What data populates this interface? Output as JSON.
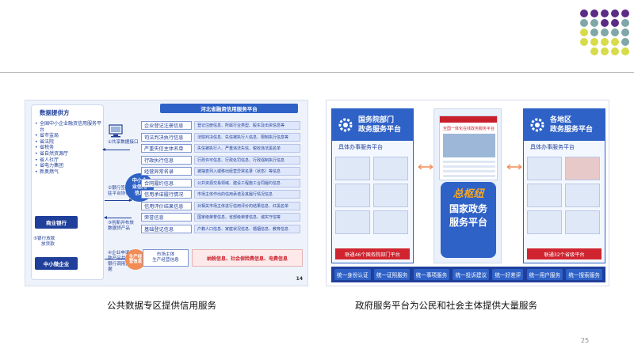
{
  "colors": {
    "dark_blue": "#1f3f9a",
    "mid_blue": "#2f62c7",
    "red": "#c8202b",
    "orange": "#f28c55",
    "dot_purple": "#5b2c86",
    "dot_teal": "#7fa7a8",
    "dot_yellow": "#d6dc4a"
  },
  "left_panel": {
    "provider_title": "数据提供方",
    "providers": [
      "全国中小企业融资信用服务平台",
      "省市监局",
      "省法院",
      "省税务",
      "省自然资源厅",
      "省人社厅",
      "省电力集团",
      "新奥燃气"
    ],
    "bank_label": "商业银行",
    "sme_label": "中小微企业",
    "step1": "①共享数据接口",
    "step2": "②银行签署入驻平台协议",
    "step3": "③创新并布放数据贷产品",
    "step4": "④企业申请贷款产品并授权银行调用其数据",
    "step5": "⑤银行放款",
    "step5b": "放贷款",
    "platform_title": "河北省融资信用服务平台",
    "sme_info_circle": "中小企业信用信息",
    "operating_circle": "生产经营信息",
    "categories": [
      {
        "name": "企业登记注册信息",
        "desc": "登记注册信息、所属行业类型、股东及出资信息等"
      },
      {
        "name": "司法判决执行信息",
        "desc": "法院判决信息、失信被执行人信息、限制执行信息等"
      },
      {
        "name": "严重失信主体名单",
        "desc": "失信被执行人、严重违法失信、税收违法黑名单"
      },
      {
        "name": "行政执行信息",
        "desc": "行政许可信息、行政处罚信息、行政强制执行信息"
      },
      {
        "name": "经营异常名录",
        "desc": "被抽查列入或移出经营异常名录（状态）等信息"
      },
      {
        "name": "合同履约信息",
        "desc": "公共资源交易领域、建设工程施工合同履约信息"
      },
      {
        "name": "信用承诺履行情况",
        "desc": "市场主体作出的信用承诺及其履行情况信息"
      },
      {
        "name": "信用评价结果信息",
        "desc": "对相关市场主体进行信用评价的结果信息、红黑名单"
      },
      {
        "name": "荣誉信息",
        "desc": "国家级荣誉信息、省部级荣誉信息、诚实守信等"
      },
      {
        "name": "基础登记信息",
        "desc": "户籍人口信息、家庭状况信息、婚姻信息、教育信息"
      }
    ],
    "market_box_line1": "市场主体",
    "market_box_line2": "生产经营信息",
    "market_box_right": "纳税信息、社会保险费信息、电费信息",
    "page_number": "14"
  },
  "right_panel": {
    "left_header": "国务院部门政务服务平台",
    "left_header_l1": "国务院部门",
    "left_header_l2": "政务服务平台",
    "left_sub": "具体办事服务平台",
    "left_red": "联通46个国务院部门平台",
    "right_header_l1": "各地区",
    "right_header_l2": "政务服务平台",
    "right_sub": "具体办事服务平台",
    "right_red": "联通32个省级平台",
    "screenshot_title": "全国一体化在线政务服务平台",
    "hub_label": "总枢纽",
    "hub_text_l1": "国家政务",
    "hub_text_l2": "服务平台",
    "bottom_items": [
      "统一身份认证",
      "统一证照服务",
      "统一事项服务",
      "统一投诉建议",
      "统一好差评",
      "统一用户服务",
      "统一搜索服务"
    ]
  },
  "captions": {
    "left": "公共数据专区提供信用服务",
    "right": "政府服务平台为公民和社会主体提供大量服务"
  },
  "slide_number": "25"
}
